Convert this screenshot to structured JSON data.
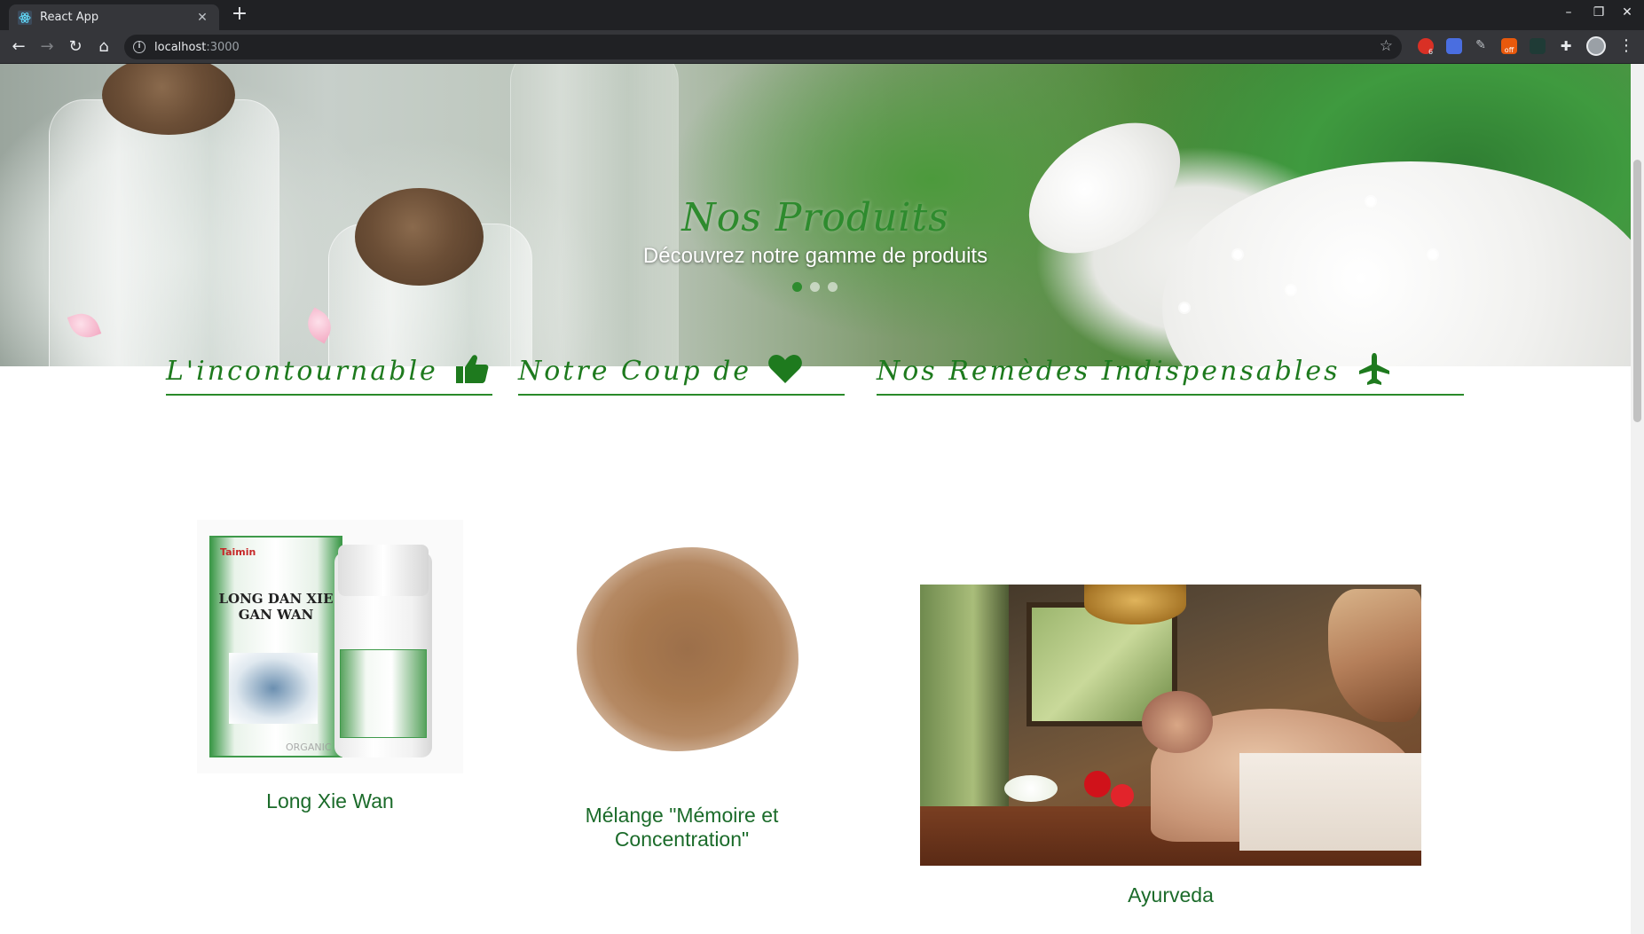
{
  "browser": {
    "tab_title": "React App",
    "url_host": "localhost",
    "url_port": ":3000",
    "extension_badge_count": "6",
    "extension_off_label": "off"
  },
  "hero": {
    "title": "Nos Produits",
    "subtitle": "Découvrez notre gamme de produits",
    "slides_total": 3,
    "active_slide": 1
  },
  "sections": [
    {
      "title": "L'incontournable",
      "icon": "thumbs-up-icon"
    },
    {
      "title": "Notre Coup de",
      "icon": "heart-icon"
    },
    {
      "title": "Nos Remèdes Indispensables",
      "icon": "airplane-icon"
    }
  ],
  "products": [
    {
      "name": "Long Xie Wan",
      "box_text": "LONG DAN XIE GAN WAN",
      "brand": "Taimin",
      "watermark": "ORGANIC"
    },
    {
      "name": "Mélange \"Mémoire et Concentration\""
    },
    {
      "name": "Ayurveda"
    }
  ],
  "colors": {
    "accent_green": "#1e7a1e",
    "hero_title_green": "#2e8b2e",
    "product_text_green": "#1b6b2a"
  }
}
